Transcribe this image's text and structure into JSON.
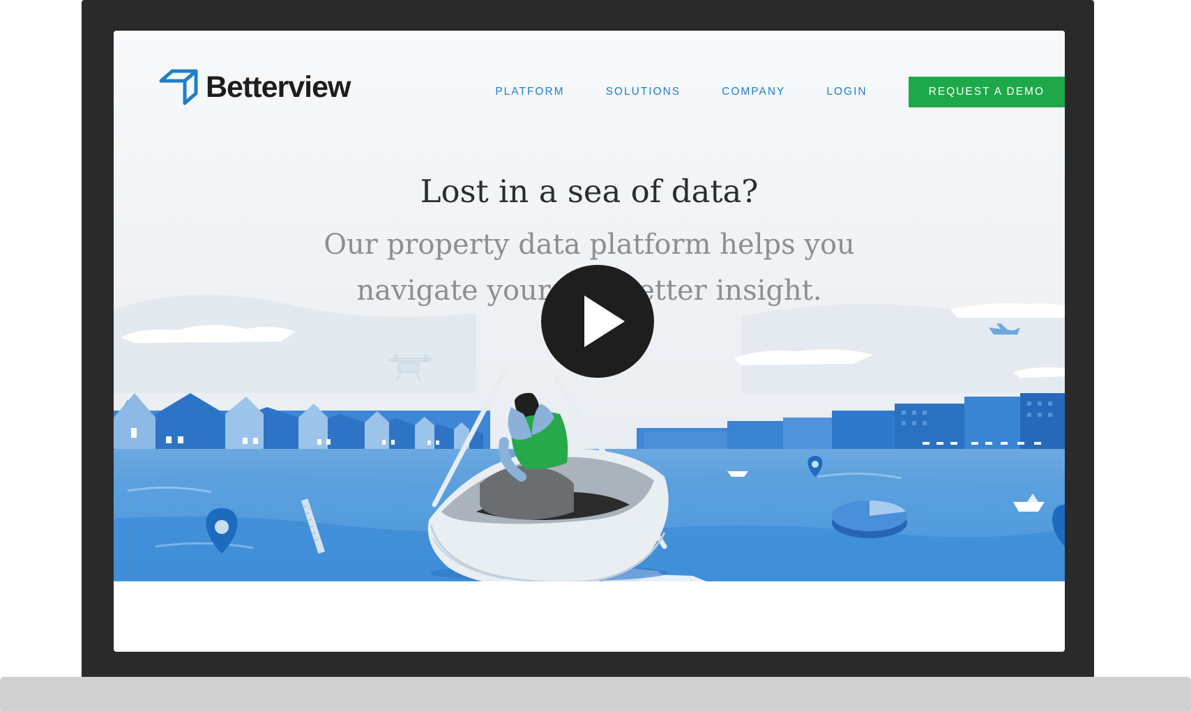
{
  "brand": {
    "name": "Betterview",
    "logo_icon": "betterview-cube-icon",
    "accent": "#1f7fc7",
    "cta_color": "#1fa84a"
  },
  "nav": {
    "items": [
      {
        "label": "PLATFORM"
      },
      {
        "label": "SOLUTIONS"
      },
      {
        "label": "COMPANY"
      },
      {
        "label": "LOGIN"
      }
    ],
    "cta_label": "REQUEST A DEMO"
  },
  "hero": {
    "headline": "Lost in a sea of data?",
    "subheadline": "Our property data platform helps you navigate your w… better insight.",
    "play_icon": "play-icon"
  }
}
